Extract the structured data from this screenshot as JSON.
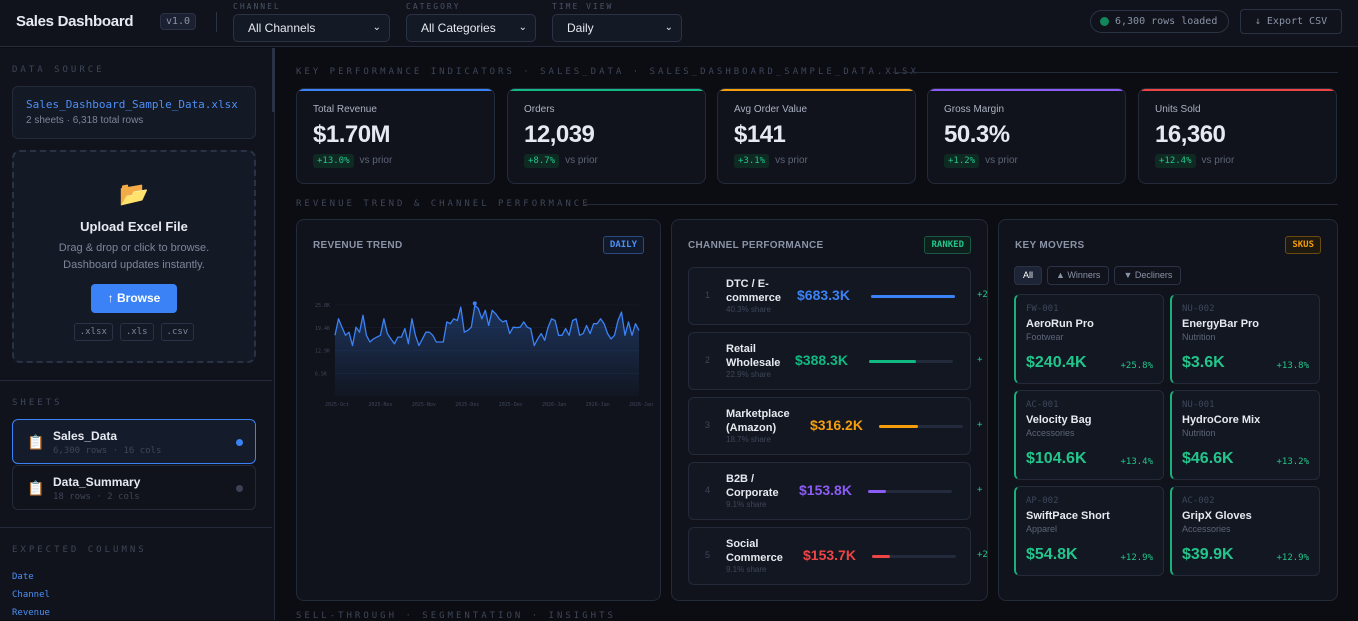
{
  "header": {
    "title": "Sales Dashboard",
    "version": "v1.0",
    "filters": [
      {
        "label": "CHANNEL",
        "value": "All Channels"
      },
      {
        "label": "CATEGORY",
        "value": "All Categories"
      },
      {
        "label": "TIME VIEW",
        "value": "Daily"
      }
    ],
    "status": "6,300 rows loaded",
    "export_label": "↓ Export CSV"
  },
  "sidebar": {
    "data_source_label": "DATA SOURCE",
    "file_name": "Sales_Dashboard_Sample_Data.xlsx",
    "file_meta": "2 sheets · 6,318 total rows",
    "upload": {
      "icon": "folder-icon",
      "title": "Upload Excel File",
      "desc1": "Drag & drop or click to browse.",
      "desc2": "Dashboard updates instantly.",
      "button": "↑ Browse",
      "extensions": [
        ".xlsx",
        ".xls",
        ".csv"
      ]
    },
    "sheets_label": "SHEETS",
    "sheets": [
      {
        "name": "Sales_Data",
        "meta": "6,300 rows · 16 cols",
        "active": true
      },
      {
        "name": "Data_Summary",
        "meta": "18 rows · 2 cols",
        "active": false
      }
    ],
    "expected_columns_label": "EXPECTED COLUMNS",
    "expected_columns": [
      "Date",
      "Channel",
      "Revenue"
    ]
  },
  "kpi_section": "KEY PERFORMANCE INDICATORS · SALES_DATA · SALES_DASHBOARD_SAMPLE_DATA.XLSX",
  "kpis": [
    {
      "label": "Total Revenue",
      "value": "$1.70M",
      "delta": "+13.0%",
      "vs": "vs prior",
      "color": "#3b82f6"
    },
    {
      "label": "Orders",
      "value": "12,039",
      "delta": "+8.7%",
      "vs": "vs prior",
      "color": "#10b981"
    },
    {
      "label": "Avg Order Value",
      "value": "$141",
      "delta": "+3.1%",
      "vs": "vs prior",
      "color": "#f59e0b"
    },
    {
      "label": "Gross Margin",
      "value": "50.3%",
      "delta": "+1.2%",
      "vs": "vs prior",
      "color": "#8b5cf6"
    },
    {
      "label": "Units Sold",
      "value": "16,360",
      "delta": "+12.4%",
      "vs": "vs prior",
      "color": "#ef4444"
    }
  ],
  "trend_section": "REVENUE TREND & CHANNEL PERFORMANCE",
  "bottom_section": "SELL-THROUGH · SEGMENTATION · INSIGHTS",
  "revenue_trend": {
    "title": "REVENUE TREND",
    "tag": "DAILY"
  },
  "chart_data": {
    "type": "line",
    "title": "",
    "ylim": [
      0,
      25.8
    ],
    "y_unit": "K",
    "y_ticks": [
      "6.5K",
      "12.9K",
      "19.4K",
      "25.8K"
    ],
    "y_tick_values": [
      6.45,
      12.9,
      19.35,
      25.8
    ],
    "x_ticks": [
      "2025-Oct",
      "2025-Nov",
      "2025-Nov",
      "2025-Dec",
      "2025-Dec",
      "2026-Jan",
      "2026-Jan",
      "2026-Jan"
    ],
    "color": "#3b82f6",
    "grid": true,
    "values": [
      17.2,
      21.9,
      19.5,
      17.2,
      18.1,
      14.3,
      19.5,
      18.1,
      22.9,
      17.2,
      15.3,
      16.2,
      16.7,
      17.2,
      21.9,
      17.7,
      16.2,
      14.8,
      16.7,
      16.7,
      19.1,
      14.8,
      21.9,
      17.2,
      14.3,
      16.2,
      18.1,
      18.1,
      17.2,
      15.3,
      15.3,
      15.3,
      21.0,
      20.5,
      21.9,
      21.4,
      25.2,
      18.1,
      18.6,
      19.5,
      25.7,
      24.8,
      21.9,
      24.3,
      20.0,
      24.3,
      23.3,
      21.9,
      21.0,
      21.4,
      17.7,
      19.5,
      19.4,
      19.5,
      21.0,
      19.5,
      19.1,
      14.3,
      16.2,
      17.7,
      15.8,
      19.5,
      21.9,
      21.4,
      17.2,
      17.2,
      19.1,
      17.2,
      21.4,
      21.9,
      17.2,
      17.7,
      20.0,
      17.7,
      20.5,
      20.5,
      21.9,
      20.5,
      17.7,
      16.2,
      17.2,
      21.4,
      23.8,
      17.2,
      21.0,
      17.2,
      20.5,
      18.6
    ],
    "peak_index": 40
  },
  "channels": {
    "title": "CHANNEL PERFORMANCE",
    "tag": "RANKED",
    "items": [
      {
        "rank": "1",
        "name": "DTC / E-commerce",
        "share": "40.3% share",
        "value": "$683.3K",
        "pct": 100,
        "delta": "+2",
        "color": "#3b82f6"
      },
      {
        "rank": "2",
        "name": "Retail Wholesale",
        "share": "22.9% share",
        "value": "$388.3K",
        "pct": 56,
        "delta": "+",
        "color": "#10b981"
      },
      {
        "rank": "3",
        "name": "Marketplace (Amazon)",
        "share": "18.7% share",
        "value": "$316.2K",
        "pct": 46,
        "delta": "+",
        "color": "#f59e0b"
      },
      {
        "rank": "4",
        "name": "B2B / Corporate",
        "share": "9.1% share",
        "value": "$153.8K",
        "pct": 22,
        "delta": "+",
        "color": "#8b5cf6"
      },
      {
        "rank": "5",
        "name": "Social Commerce",
        "share": "9.1% share",
        "value": "$153.7K",
        "pct": 22,
        "delta": "+2",
        "color": "#ef4444"
      }
    ]
  },
  "movers": {
    "title": "KEY MOVERS",
    "tag": "SKUS",
    "filters": [
      "All",
      "▲ Winners",
      "▼ Decliners"
    ],
    "items": [
      {
        "sku": "FW-001",
        "name": "AeroRun Pro",
        "category": "Footwear",
        "value": "$240.4K",
        "change": "+25.8%"
      },
      {
        "sku": "NU-002",
        "name": "EnergyBar Pro",
        "category": "Nutrition",
        "value": "$3.6K",
        "change": "+13.8%"
      },
      {
        "sku": "AC-001",
        "name": "Velocity Bag",
        "category": "Accessories",
        "value": "$104.6K",
        "change": "+13.4%"
      },
      {
        "sku": "NU-001",
        "name": "HydroCore Mix",
        "category": "Nutrition",
        "value": "$46.6K",
        "change": "+13.2%"
      },
      {
        "sku": "AP-002",
        "name": "SwiftPace Short",
        "category": "Apparel",
        "value": "$54.8K",
        "change": "+12.9%"
      },
      {
        "sku": "AC-002",
        "name": "GripX Gloves",
        "category": "Accessories",
        "value": "$39.9K",
        "change": "+12.9%"
      }
    ]
  }
}
